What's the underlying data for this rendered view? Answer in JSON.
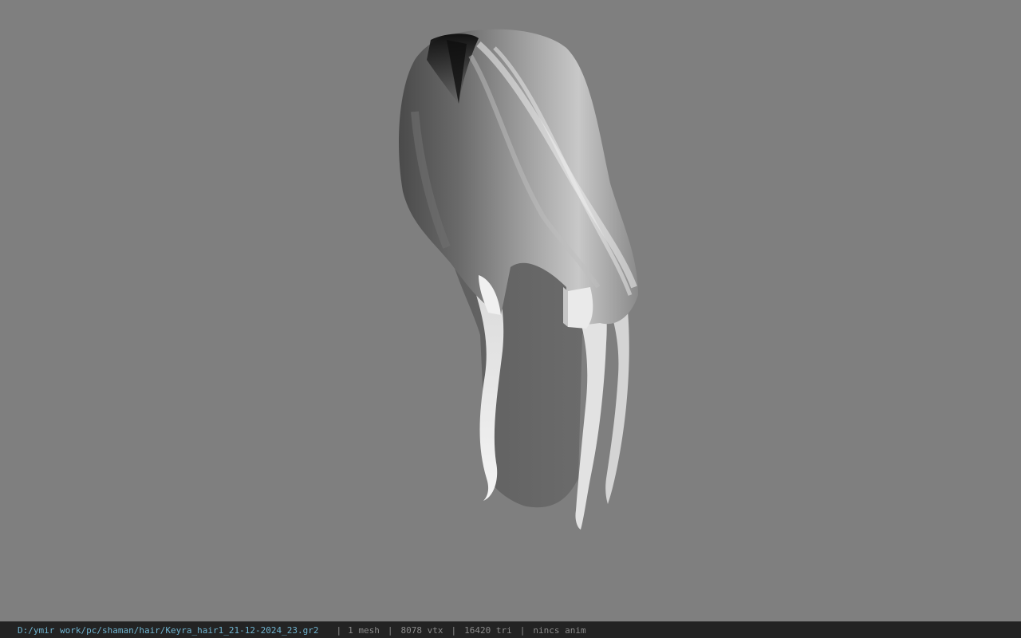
{
  "viewport": {
    "background": "#7f7f7f",
    "model_icon": "hair-mesh"
  },
  "statusbar": {
    "file_path": "D:/ymir work/pc/shaman/hair/Keyra_hair1_21-12-2024_23.gr2",
    "separator": "|",
    "mesh_count": "1 mesh",
    "vertex_count": "8078 vtx",
    "triangle_count": "16420 tri",
    "anim_status": "nincs anim",
    "path_color": "#6fb3cf",
    "text_color": "#8a8a8a"
  }
}
